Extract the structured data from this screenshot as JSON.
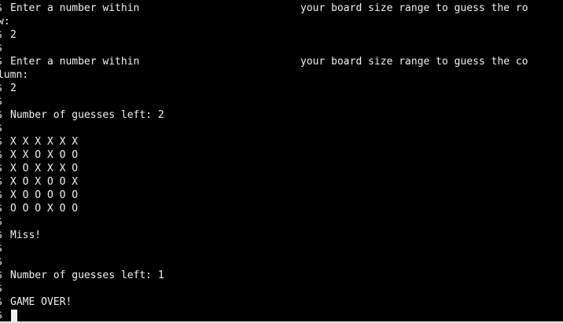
{
  "terminal": {
    "prompt_char": "$",
    "lines": {
      "row_prompt_left": "Enter a number within",
      "row_prompt_right": "your board size range to guess the ro",
      "row_prompt_wrap": "w:",
      "row_answer": "2",
      "col_prompt_left": "Enter a number within",
      "col_prompt_right": "your board size range to guess the co",
      "col_prompt_wrap": "lumn:",
      "col_answer": "2",
      "guesses_left_1": "Number of guesses left: 2",
      "miss": "Miss!",
      "guesses_left_2": "Number of guesses left: 1",
      "game_over": "GAME OVER!"
    },
    "board": [
      "X X X X X X",
      "X X O X O O",
      "X O X X X O",
      "X O X O O X",
      "X O O O O O",
      "O O O X O O"
    ]
  },
  "colors": {
    "background": "#000000",
    "text": "#f0f0f0"
  }
}
